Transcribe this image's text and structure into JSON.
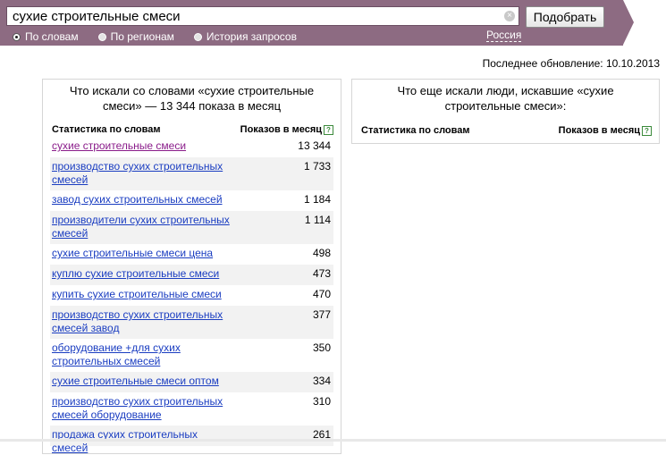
{
  "search": {
    "query": "сухие строительные смеси",
    "button_label": "Подобрать",
    "clear_glyph": "×"
  },
  "modes": [
    {
      "label": "По словам",
      "checked": true
    },
    {
      "label": "По регионам",
      "checked": false
    },
    {
      "label": "История запросов",
      "checked": false
    }
  ],
  "region": "Россия",
  "last_update": "Последнее обновление: 10.10.2013",
  "left_panel": {
    "title": "Что искали со словами «сухие строительные смеси» — 13 344 показа в месяц",
    "col_words": "Статистика по словам",
    "col_shows": "Показов в месяц",
    "help_glyph": "?",
    "rows": [
      {
        "text": "сухие строительные смеси",
        "count": "13 344",
        "visited": true
      },
      {
        "text": "производство сухих строительных смесей",
        "count": "1 733"
      },
      {
        "text": "завод сухих строительных смесей",
        "count": "1 184"
      },
      {
        "text": "производители сухих строительных смесей",
        "count": "1 114"
      },
      {
        "text": "сухие строительные смеси цена",
        "count": "498"
      },
      {
        "text": "куплю сухие строительные смеси",
        "count": "473"
      },
      {
        "text": "купить сухие строительные смеси",
        "count": "470"
      },
      {
        "text": "производство сухих строительных смесей завод",
        "count": "377"
      },
      {
        "text": "оборудование +для сухих строительных смесей",
        "count": "350"
      },
      {
        "text": "сухие строительные смеси оптом",
        "count": "334"
      },
      {
        "text": "производство сухих строительных смесей оборудование",
        "count": "310"
      },
      {
        "text": "продажа сухих строительных смесей",
        "count": "261"
      }
    ]
  },
  "right_panel": {
    "title": "Что еще искали люди, искавшие «сухие строительные смеси»:",
    "col_words": "Статистика по словам",
    "col_shows": "Показов в месяц",
    "help_glyph": "?"
  },
  "colors": {
    "bar": "#8d6b82",
    "link": "#1a3dc1",
    "visited_link": "#8a1c8a",
    "help": "#3b8a3b"
  }
}
